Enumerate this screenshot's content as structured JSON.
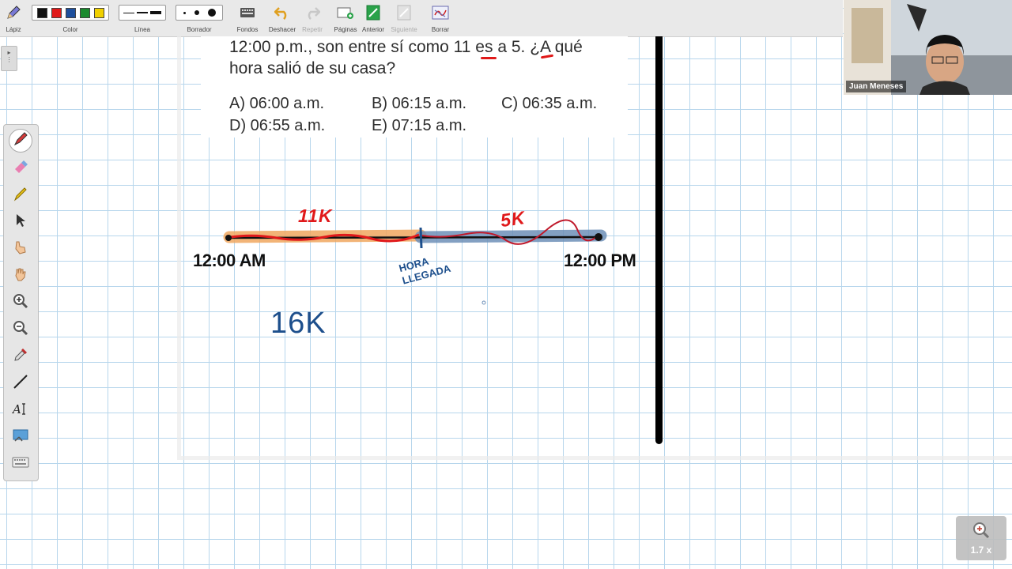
{
  "toolbar": {
    "pencil_label": "Lápiz",
    "color_label": "Color",
    "line_label": "Línea",
    "eraser_label": "Borrador",
    "backgrounds_label": "Fondos",
    "undo_label": "Deshacer",
    "redo_label": "Repetir",
    "pages_label": "Páginas",
    "previous_label": "Anterior",
    "next_label": "Siguiente",
    "clear_label": "Borrar",
    "colors": [
      "#111111",
      "#e01919",
      "#1d4f9c",
      "#1a8a2e",
      "#f0d000"
    ]
  },
  "question": {
    "line1_a": "12:00 p.m., son entre sí como ",
    "line1_n1": "11",
    "line1_b": " es a ",
    "line1_n2": "5",
    "line1_c": ". ¿A qué",
    "line2": "hora salió de su casa?",
    "options": [
      {
        "letter": "A)",
        "text": "06:00 a.m."
      },
      {
        "letter": "B)",
        "text": "06:15 a.m."
      },
      {
        "letter": "C)",
        "text": "06:35 a.m."
      },
      {
        "letter": "D)",
        "text": "06:55 a.m."
      },
      {
        "letter": "E)",
        "text": "07:15 a.m."
      }
    ]
  },
  "annotations": {
    "left_ratio": "11K",
    "right_ratio": "5K",
    "start_time": "12:00 AM",
    "end_time": "12:00 PM",
    "arrival_line1": "HORA",
    "arrival_line2": "LLEGADA",
    "total": "16K"
  },
  "webcam": {
    "name": "Juan Meneses"
  },
  "zoom": {
    "level": "1.7 x"
  }
}
